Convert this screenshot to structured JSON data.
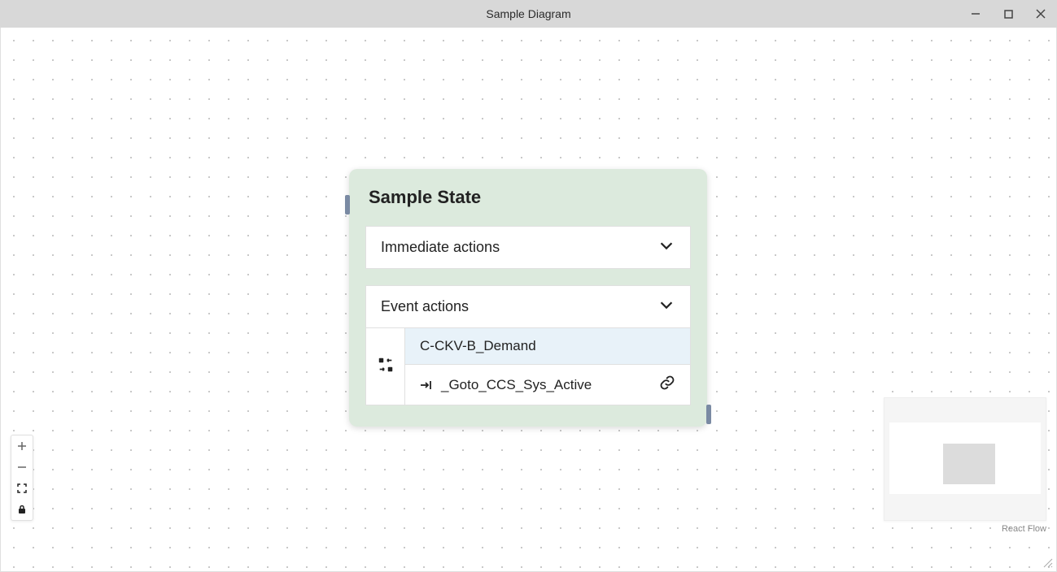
{
  "window": {
    "title": "Sample Diagram"
  },
  "node": {
    "title": "Sample State",
    "immediate": {
      "label": "Immediate actions"
    },
    "event": {
      "label": "Event actions",
      "trigger": "C-CKV-B_Demand",
      "goto": "_Goto_CCS_Sys_Active"
    }
  },
  "attribution": "React Flow"
}
